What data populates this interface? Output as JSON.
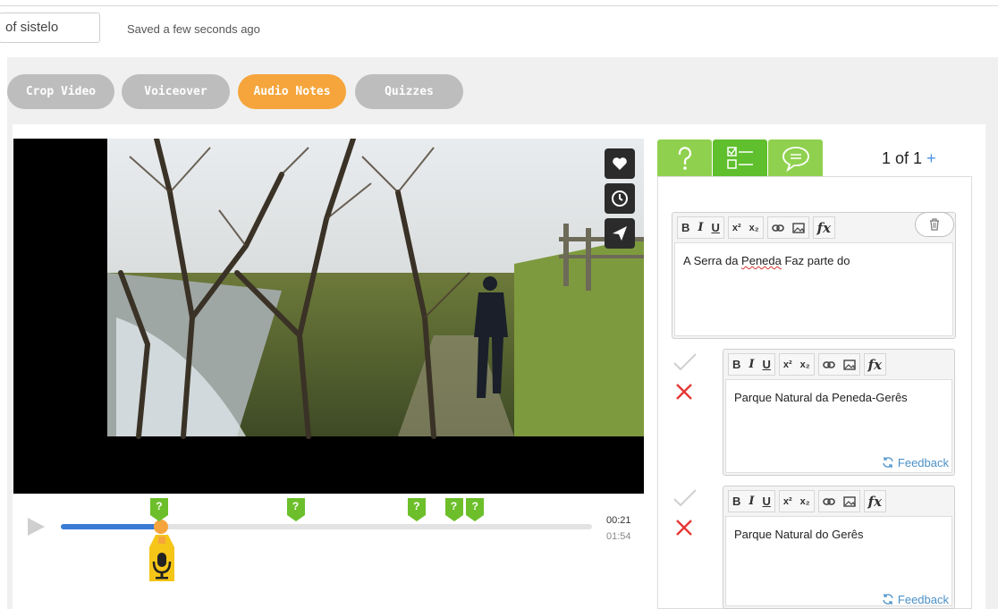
{
  "header": {
    "title_value": "of sistelo",
    "save_status": "Saved a few seconds ago"
  },
  "tabs": [
    {
      "label": "Crop Video",
      "active": false
    },
    {
      "label": "Voiceover",
      "active": false
    },
    {
      "label": "Audio Notes",
      "active": true
    },
    {
      "label": "Quizzes",
      "active": false
    }
  ],
  "video_controls": {
    "actions": [
      "heart-icon",
      "clock-icon",
      "send-icon"
    ],
    "current_time": "00:21",
    "total_time": "01:54",
    "progress": 0.184,
    "question_markers": [
      {
        "label": "?",
        "time_fraction": 0.185
      },
      {
        "label": "?",
        "time_fraction": 0.442
      },
      {
        "label": "?",
        "time_fraction": 0.67
      },
      {
        "label": "?",
        "time_fraction": 0.74
      },
      {
        "label": "?",
        "time_fraction": 0.78
      }
    ]
  },
  "quiz_panel": {
    "tabs": [
      "question-icon",
      "checklist-icon",
      "comment-icon"
    ],
    "active_tab": "checklist-icon",
    "counter_label": "1 of 1",
    "add_label": "+",
    "toolbar": {
      "bold": "B",
      "italic": "I",
      "underline": "U",
      "superscript": "x²",
      "subscript": "x₂",
      "formula": "fx"
    },
    "question": {
      "text_before": "A Serra da ",
      "misspelled": "Peneda",
      "text_after": " Faz parte do"
    },
    "answers": [
      {
        "text": "Parque Natural da Peneda-Gerês",
        "feedback_label": "Feedback"
      },
      {
        "text": "Parque Natural do Gerês",
        "feedback_label": "Feedback"
      }
    ]
  },
  "colors": {
    "accent_orange": "#f5a53c",
    "quiz_green": "#8fd14f",
    "progress_blue": "#3a7bd5",
    "marker_green": "#6cbf2a",
    "wrong_red": "#e53935"
  }
}
